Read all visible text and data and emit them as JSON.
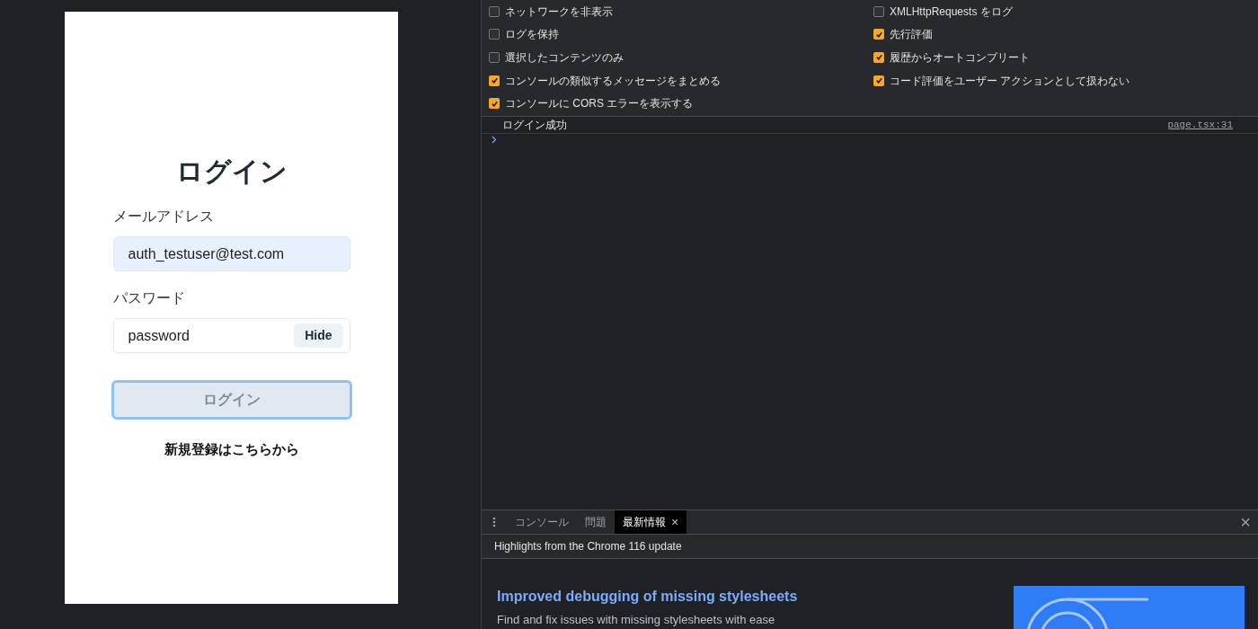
{
  "login": {
    "title": "ログイン",
    "email_label": "メールアドレス",
    "email_value": "auth_testuser@test.com",
    "password_label": "パスワード",
    "password_value": "password",
    "toggle_button": "Hide",
    "submit_button": "ログイン",
    "submit_disabled": true,
    "register_link": "新規登録はこちらから"
  },
  "console_settings": {
    "columns": [
      [
        {
          "label": "ネットワークを非表示",
          "checked": false
        },
        {
          "label": "ログを保持",
          "checked": false
        },
        {
          "label": "選択したコンテンツのみ",
          "checked": false
        },
        {
          "label": "コンソールの類似するメッセージをまとめる",
          "checked": true
        },
        {
          "label": "コンソールに CORS エラーを表示する",
          "checked": true
        }
      ],
      [
        {
          "label": "XMLHttpRequests をログ",
          "checked": false
        },
        {
          "label": "先行評価",
          "checked": true
        },
        {
          "label": "履歴からオートコンプリート",
          "checked": true
        },
        {
          "label": "コード評価をユーザー アクションとして扱わない",
          "checked": true
        }
      ]
    ]
  },
  "console_messages": [
    {
      "text": "ログイン成功",
      "source": "page.tsx:31"
    }
  ],
  "drawer": {
    "tabs": [
      {
        "label": "コンソール",
        "selected": false,
        "closable": false
      },
      {
        "label": "問題",
        "selected": false,
        "closable": false
      },
      {
        "label": "最新情報",
        "selected": true,
        "closable": true
      }
    ],
    "close_symbol": "×",
    "header": "Highlights from the Chrome 116 update",
    "article": {
      "title": "Improved debugging of missing stylesheets",
      "body": "Find and fix issues with missing stylesheets with ease"
    }
  }
}
